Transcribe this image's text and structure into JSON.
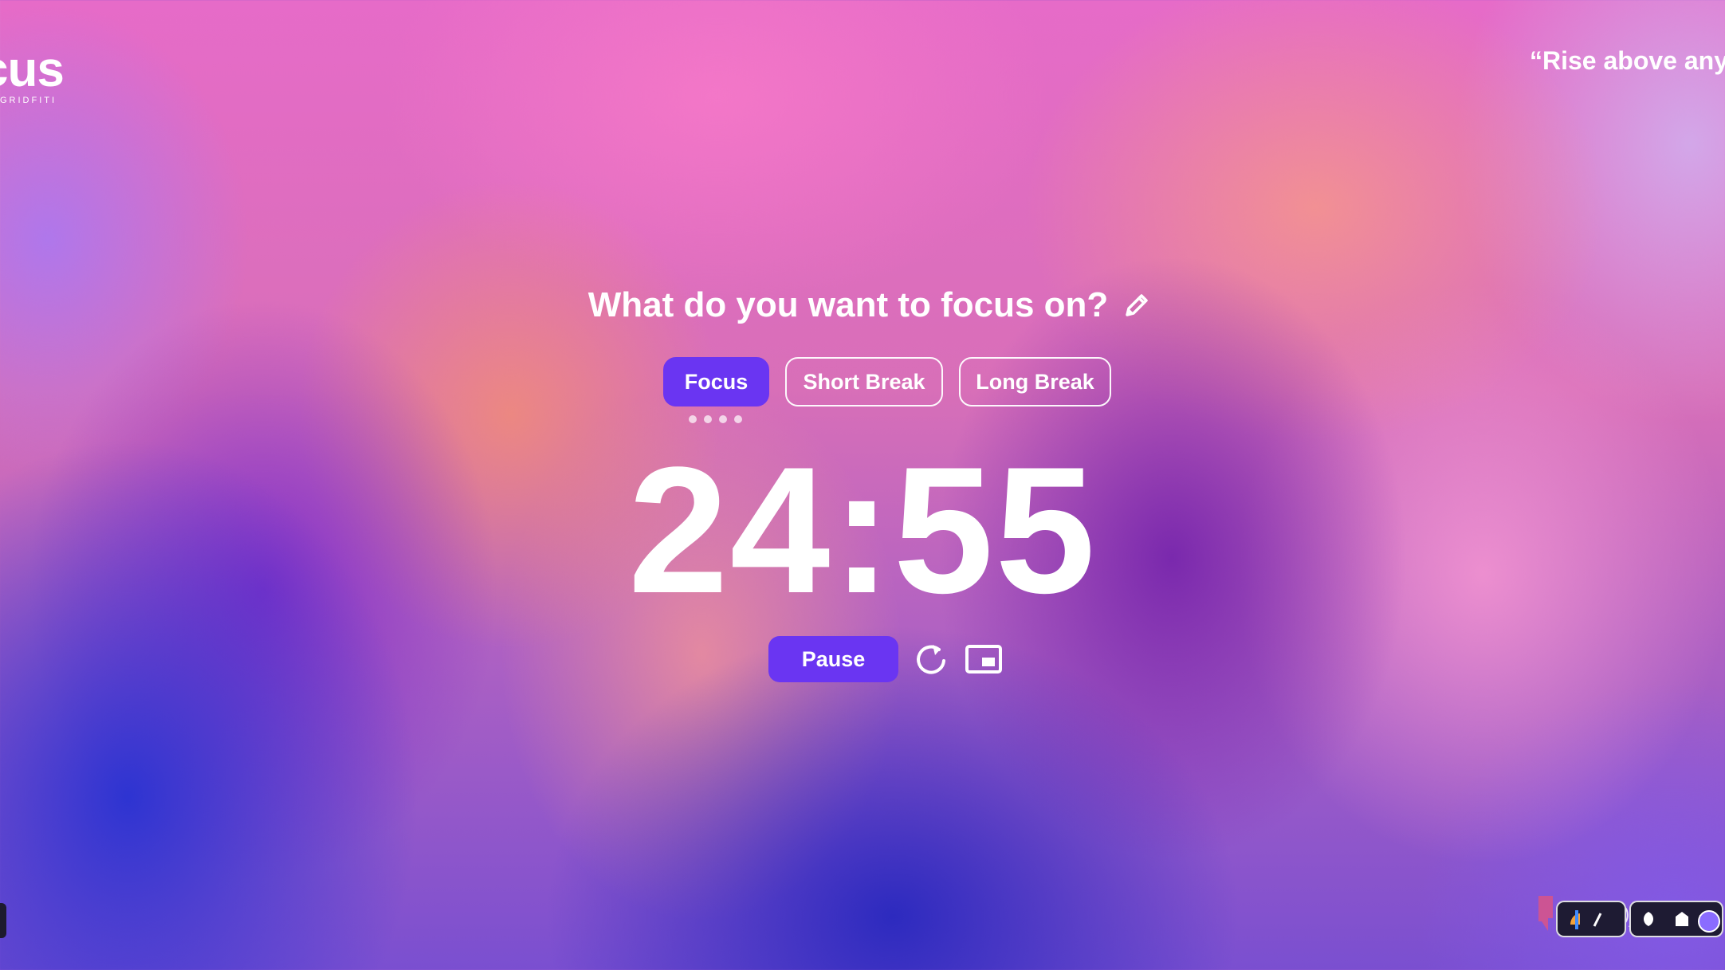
{
  "logo": {
    "word": "cus",
    "sub": "GRIDFITI"
  },
  "quote": {
    "text": "“Rise above any"
  },
  "task": {
    "title": "What do you want to focus on?"
  },
  "modes": {
    "focus": "Focus",
    "short_break": "Short Break",
    "long_break": "Long Break",
    "active": "Focus"
  },
  "session_dots": 4,
  "timer": {
    "display": "24:55"
  },
  "controls": {
    "pause_label": "Pause"
  },
  "icons": {
    "edit": "pencil-icon",
    "reset": "restart-icon",
    "pip": "picture-in-picture-icon"
  },
  "colors": {
    "accent": "#6a35f2",
    "text": "#ffffff"
  }
}
